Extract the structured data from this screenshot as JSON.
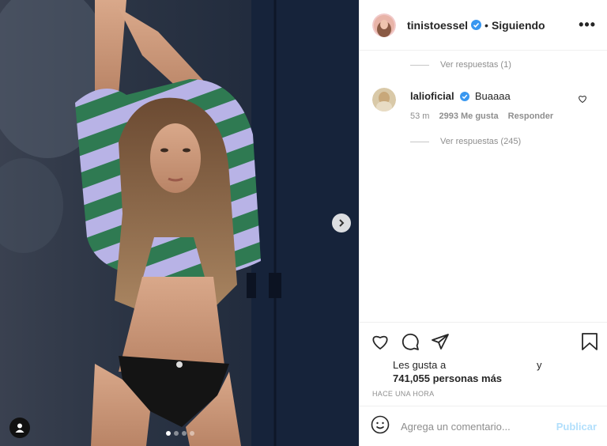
{
  "post": {
    "author": "tinistoessel",
    "follow_separator": "•",
    "follow_status": "Siguiendo",
    "more_label": "•••",
    "carousel_pages": 4,
    "carousel_active_page": 1
  },
  "comments": {
    "view_replies_top": "Ver respuestas (1)",
    "item": {
      "username": "lalioficial",
      "text": "Buaaaa",
      "time": "53 m",
      "likes": "2993 Me gusta",
      "reply": "Responder",
      "view_replies": "Ver respuestas (245)"
    }
  },
  "actions": {
    "likes_line1": "Les gusta a",
    "likes_and": "y",
    "likes_line2": "741,055 personas más",
    "timestamp": "HACE UNA HORA"
  },
  "composer": {
    "placeholder": "Agrega un comentario...",
    "publish_label": "Publicar"
  },
  "colors": {
    "verified": "#3897f0",
    "publish_disabled": "#b2dffc",
    "secondary_text": "#8e8e8e"
  },
  "icons": [
    "chevron-right-icon",
    "user-tag-icon",
    "verified-badge-icon",
    "more-options-icon",
    "heart-icon",
    "comment-icon",
    "share-icon",
    "bookmark-icon",
    "emoji-icon"
  ]
}
